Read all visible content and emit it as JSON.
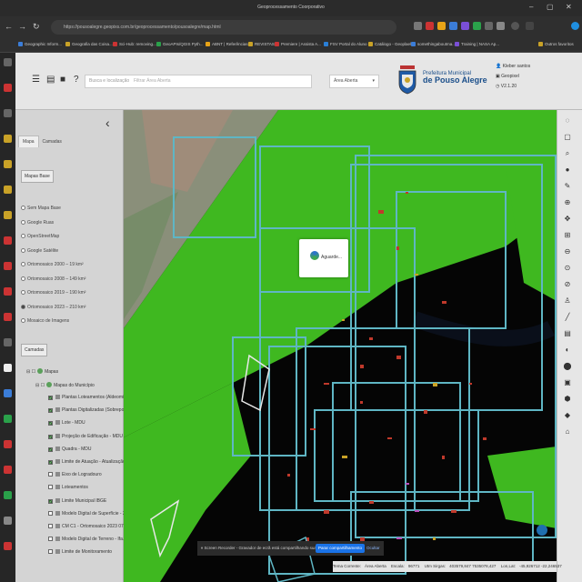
{
  "browser": {
    "title": "Geoprocessamento Coorporativo",
    "url": "https://pousoalegre.geopixs.com.br/geoprocessamento/pousoalegre/map.html",
    "bookmarks": [
      "Geographic Inform...",
      "Geografia das Coisa...",
      "Sci-Hub: removing...",
      "GeoAPIs/QGIS Pyth...",
      "ABNT | Referências...",
      "REVISTAS",
      "Premiere | Assista A...",
      "FSV Portal do Aluno",
      "Catálogo - Geoplael",
      "somethingaboutma...",
      "Training | NASA Ap...",
      "Outros favoritos"
    ]
  },
  "header": {
    "search_placeholder": "Busca e localização",
    "search_placeholder2": "Filtrar Área Aberta",
    "area_select": "Área Aberta",
    "org_line1": "Prefeitura Municipal",
    "org_line2": "de Pouso Alegre",
    "user_name": "Kleber santos",
    "user_role": "Geopixel",
    "version": "V2.1.20"
  },
  "panel": {
    "tabs": [
      "Mapa",
      "Camadas"
    ],
    "mapa_base_button": "Mapas Base",
    "basemaps": [
      {
        "label": "Sem Mapa Base",
        "selected": false
      },
      {
        "label": "Google Ruas",
        "selected": false
      },
      {
        "label": "OpenStreetMap",
        "selected": false
      },
      {
        "label": "Google Satélite",
        "selected": false
      },
      {
        "label": "Ortomosaico 2000 – 19 km²",
        "selected": false
      },
      {
        "label": "Ortomosaico 2008 – 149 km²",
        "selected": false
      },
      {
        "label": "Ortomosaico 2019 – 190 km²",
        "selected": false
      },
      {
        "label": "Ortomosaico 2023 – 210 km²",
        "selected": true
      },
      {
        "label": "Mosaico de Imagens",
        "selected": false
      }
    ],
    "camadas_button": "Camadas",
    "tree_root": "Mapas",
    "tree_group": "Mapas do Município",
    "layers": [
      {
        "label": "Plantas Loteamentos (Aldeomi...",
        "checked": true
      },
      {
        "label": "Plantas Digitalizadas (Sobrepo...",
        "checked": true
      },
      {
        "label": "Lote - MDU",
        "checked": true
      },
      {
        "label": "Projeção de Edificação - MDU",
        "checked": true
      },
      {
        "label": "Quadra - MDU",
        "checked": true
      },
      {
        "label": "Limite de Atuação - Atualização...",
        "checked": true
      },
      {
        "label": "Eixo de Logradouro",
        "checked": false
      },
      {
        "label": "Loteamentos",
        "checked": false
      },
      {
        "label": "Limite Municipal IBGE",
        "checked": true
      },
      {
        "label": "Modelo Digital de Superfície - 2...",
        "checked": false
      },
      {
        "label": "CM C1 - Ortomosaico 2023 07...",
        "checked": false
      },
      {
        "label": "Modelo Digital de Terreno - Ifa...",
        "checked": false
      },
      {
        "label": "Limite de Monitoramento",
        "checked": false
      }
    ]
  },
  "map": {
    "loading_text": "Aguarde...",
    "colors": {
      "field": "#3fb820",
      "building": "#c0392b",
      "outline": "#5fb6c4"
    }
  },
  "status": {
    "tema_label": "Tema Corrente:",
    "tema_value": "Área Aberta",
    "escala_label": "Escala:",
    "escala_value": "96771",
    "utm_label": "Utm Sirgas:",
    "utm_value": "403579,847 7535078,427",
    "lonlat_label": "Lon,Lat:",
    "lonlat_value": "-45,926712 -22,246537"
  },
  "notification": {
    "text": "Screen Recorder - Gravador de ecrã está compartilhando sua tela.",
    "stop_button": "Parar compartilhamento",
    "hide_link": "Ocultar"
  }
}
